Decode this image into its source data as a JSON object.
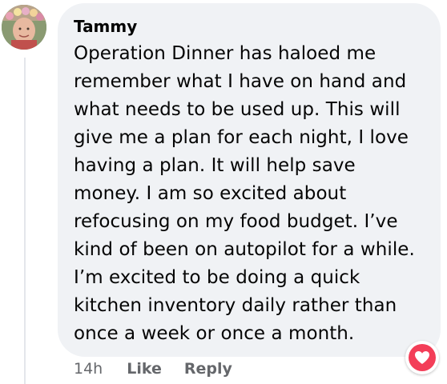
{
  "comment": {
    "author": "Tammy",
    "text": "Operation Dinner has haloed me remember what I have on hand and what needs to be used up. This will give me a plan for each night, I love having a plan. It will help save money. I am so excited about refocusing on my food budget. I’ve kind of been on autopilot for a while. I’m excited to be doing a quick kitchen inventory daily rather than once a week or once a month.",
    "timestamp": "14h",
    "like_label": "Like",
    "reply_label": "Reply",
    "reaction": "heart-icon"
  },
  "colors": {
    "bubble_bg": "#f0f2f5",
    "text": "#050505",
    "meta": "#65676b",
    "heart": "#f33e58"
  }
}
